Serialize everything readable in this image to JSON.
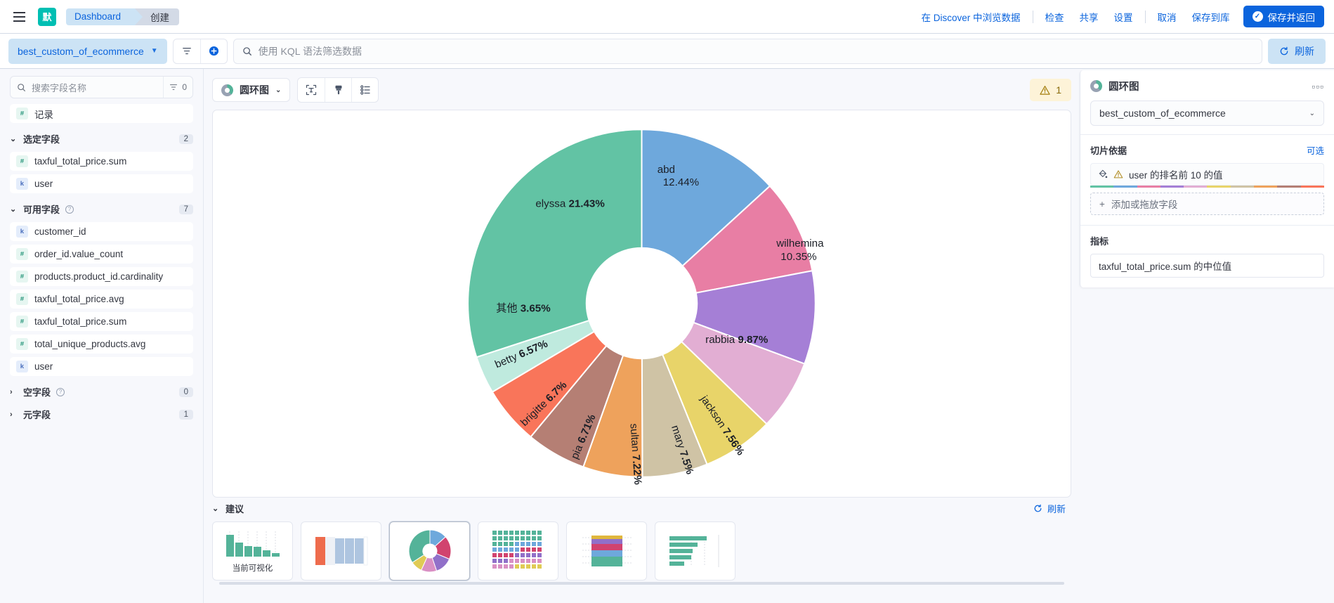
{
  "header": {
    "menu_icon": "hamburger-icon",
    "space_initial": "默",
    "breadcrumb_dashboard": "Dashboard",
    "breadcrumb_create": "创建",
    "links": [
      "在 Discover 中浏览数据",
      "检查",
      "共享",
      "设置",
      "取消",
      "保存到库"
    ],
    "discover_link": "在 Discover 中浏览数据",
    "inspect_link": "检查",
    "share_link": "共享",
    "settings_link": "设置",
    "cancel_link": "取消",
    "save_to_library_link": "保存到库",
    "save_and_return": "保存并返回",
    "accent": "#0b64dd"
  },
  "query": {
    "data_view": "best_custom_of_ecommerce",
    "filter_icon": "filter-icon",
    "add_filter_icon": "add-filter-icon",
    "placeholder": "使用 KQL 语法筛选数据",
    "search_icon": "search-icon",
    "refresh_label": "刷新"
  },
  "sidebar": {
    "search_placeholder": "搜索字段名称",
    "filter_count": "0",
    "records_field": {
      "label": "记录",
      "type": "#"
    },
    "selected_section": {
      "label": "选定字段",
      "count": "2"
    },
    "selected_fields": [
      {
        "label": "taxful_total_price.sum",
        "type": "#"
      },
      {
        "label": "user",
        "type": "k"
      }
    ],
    "available_section": {
      "label": "可用字段",
      "count": "7"
    },
    "available_fields": [
      {
        "label": "customer_id",
        "type": "k"
      },
      {
        "label": "order_id.value_count",
        "type": "#"
      },
      {
        "label": "products.product_id.cardinality",
        "type": "#"
      },
      {
        "label": "taxful_total_price.avg",
        "type": "#"
      },
      {
        "label": "taxful_total_price.sum",
        "type": "#"
      },
      {
        "label": "total_unique_products.avg",
        "type": "#"
      },
      {
        "label": "user",
        "type": "k"
      }
    ],
    "empty_section": {
      "label": "空字段",
      "count": "0"
    },
    "meta_section": {
      "label": "元字段",
      "count": "1"
    }
  },
  "toolbar": {
    "vis_type": "圆环图",
    "labels_icon": "text-labels-icon",
    "appearance_icon": "paintbrush-icon",
    "legend_icon": "legend-settings-icon",
    "warning_count": "1",
    "warning_icon": "warning-triangle-icon"
  },
  "config_panel": {
    "title": "圆环图",
    "more_icon": "more-options-icon",
    "data_view": "best_custom_of_ecommerce",
    "slice_by_label": "切片依据",
    "optional_label": "可选",
    "slice_dimension": "user 的排名前 10 的值",
    "slice_warning_icon": "warning-triangle-icon",
    "palette_icon": "palette-icon",
    "add_field_label": "添加或拖放字段",
    "metric_label": "指标",
    "metric_value": "taxful_total_price.sum 的中位值"
  },
  "suggestions": {
    "title": "建议",
    "refresh_label": "刷新",
    "current_label": "当前可视化",
    "cards": [
      {
        "name": "bar-chart-suggestion",
        "label": "当前可视化",
        "selected": false
      },
      {
        "name": "stacked-bar-suggestion",
        "label": "",
        "selected": false
      },
      {
        "name": "donut-suggestion",
        "label": "",
        "selected": true
      },
      {
        "name": "waffle-suggestion",
        "label": "",
        "selected": false
      },
      {
        "name": "stacked-column-suggestion",
        "label": "",
        "selected": false
      },
      {
        "name": "horizontal-bar-suggestion",
        "label": "",
        "selected": false
      }
    ]
  },
  "chart_data": {
    "type": "pie",
    "title": "圆环图",
    "donut": true,
    "legend_position": "none",
    "labels_inside": true,
    "categories": [
      "abd",
      "wilhemina",
      "rabbia",
      "jackson",
      "mary",
      "sultan",
      "pia",
      "brigitte",
      "betty",
      "其他",
      "elyssa"
    ],
    "values": [
      12.44,
      10.35,
      9.87,
      7.56,
      7.5,
      7.22,
      6.71,
      6.7,
      6.57,
      3.65,
      21.43
    ],
    "unit": "%",
    "colors": [
      "#6fa8dc",
      "#e островок",
      "#a57fd6",
      "#e2aed3",
      "#e8d469",
      "#cfc3a5",
      "#eea25c",
      "#b57f74",
      "#f9755a",
      "#bfeade",
      "#62c3a4"
    ],
    "slices": [
      {
        "label": "abd",
        "value": 12.44,
        "color": "#6ea8dc"
      },
      {
        "label": "wilhemina",
        "value": 10.35,
        "color": "#e87ea4"
      },
      {
        "label": "rabbia",
        "value": 9.87,
        "color": "#a57fd6"
      },
      {
        "label": "jackson",
        "value": 7.56,
        "color": "#e2aed3"
      },
      {
        "label": "mary",
        "value": 7.5,
        "color": "#e8d469"
      },
      {
        "label": "sultan",
        "value": 7.22,
        "color": "#cfc3a5"
      },
      {
        "label": "pia",
        "value": 6.71,
        "color": "#eea25c"
      },
      {
        "label": "brigitte",
        "value": 6.7,
        "color": "#b57f74"
      },
      {
        "label": "betty",
        "value": 6.57,
        "color": "#f9755a"
      },
      {
        "label": "其他",
        "value": 3.65,
        "color": "#bfeade"
      },
      {
        "label": "elyssa",
        "value": 21.43,
        "color": "#62c3a4"
      }
    ]
  }
}
